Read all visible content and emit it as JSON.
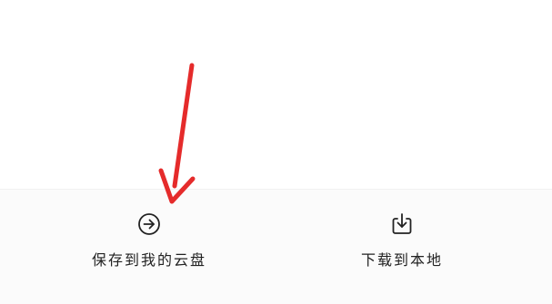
{
  "actions": {
    "save": {
      "label": "保存到我的云盘",
      "icon": "arrow-right-circle-icon"
    },
    "download": {
      "label": "下载到本地",
      "icon": "download-tray-icon"
    }
  },
  "colors": {
    "annotation_arrow": "#e52b2b",
    "action_bar_bg": "#fbfbfb",
    "label_text": "#222222"
  }
}
